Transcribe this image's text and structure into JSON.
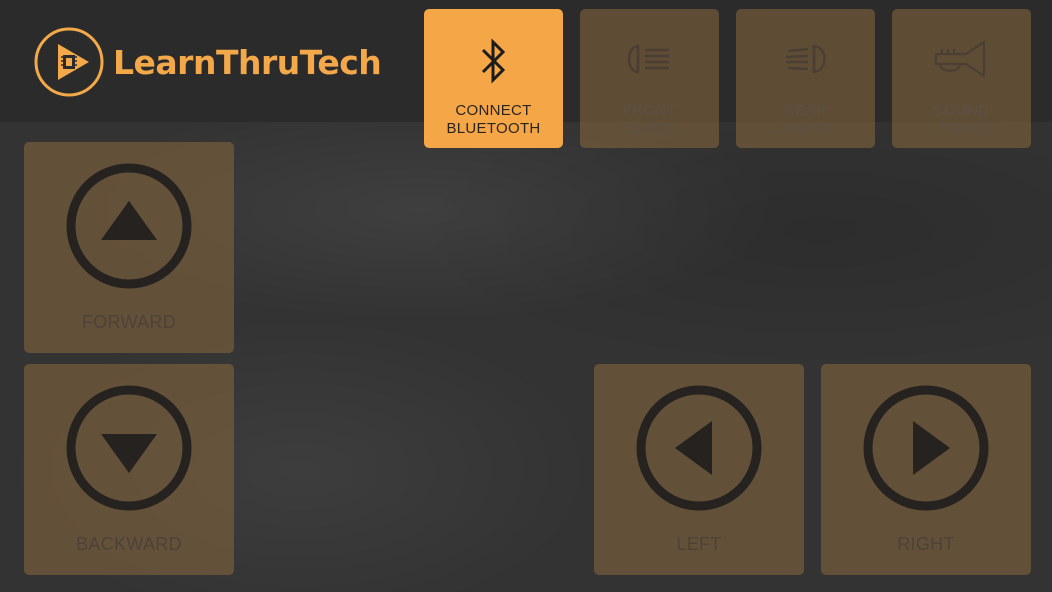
{
  "brand": {
    "name": "LearnThruTech",
    "color": "#f3a94a"
  },
  "top_buttons": [
    {
      "line1": "CONNECT",
      "line2": "BLUETOOTH",
      "icon": "bluetooth-icon",
      "active": true
    },
    {
      "line1": "FRONT",
      "line2": "LIGHTS",
      "icon": "headlight-icon",
      "active": false
    },
    {
      "line1": "REAR",
      "line2": "LIGHTS",
      "icon": "rear-light-icon",
      "active": false
    },
    {
      "line1": "SOUND",
      "line2": "HORN",
      "icon": "horn-icon",
      "active": false
    }
  ],
  "controls": {
    "forward": {
      "label": "FORWARD",
      "icon": "arrow-up-icon"
    },
    "backward": {
      "label": "BACKWARD",
      "icon": "arrow-down-icon"
    },
    "left": {
      "label": "LEFT",
      "icon": "arrow-left-icon"
    },
    "right": {
      "label": "RIGHT",
      "icon": "arrow-right-icon"
    }
  },
  "colors": {
    "accent": "#f5a647",
    "background": "#333333",
    "button_inactive": "#8a683c"
  }
}
